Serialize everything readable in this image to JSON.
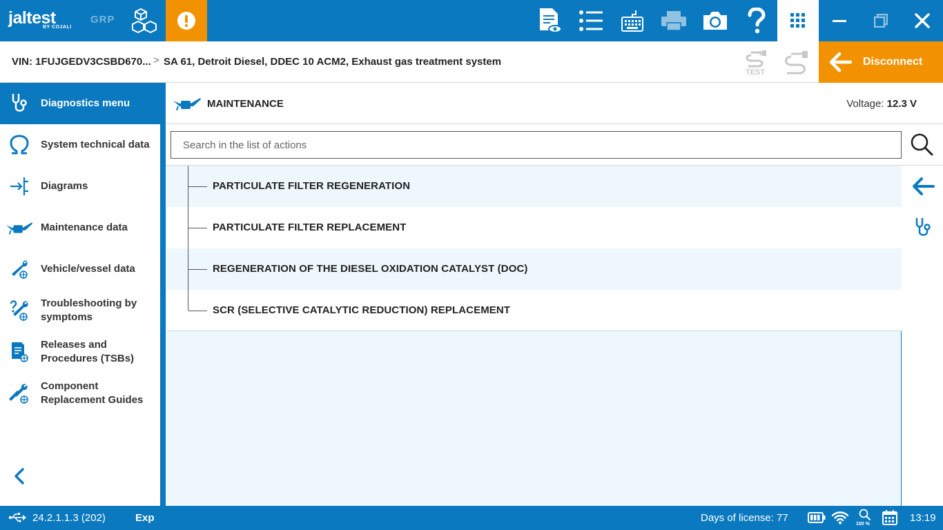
{
  "brand": {
    "logo_main": "jaltest",
    "logo_sub": "BY COJALI",
    "grp": "GRP"
  },
  "colors": {
    "primary": "#0b79bf",
    "accent": "#f39200",
    "row_tint": "#eef7fc"
  },
  "toolbar": {
    "icons": [
      "alert-icon",
      "report-view-icon",
      "list-icon",
      "keyboard-icon",
      "printer-icon",
      "camera-icon",
      "help-icon",
      "apps-grid-icon",
      "minimize-icon",
      "restore-icon",
      "close-icon"
    ]
  },
  "breadcrumb": {
    "vin": "VIN: 1FUJGEDV3CSBD670...",
    "separator": ">",
    "path": "SA 61, Detroit Diesel, DDEC 10 ACM2, Exhaust gas treatment system"
  },
  "connection": {
    "test_label": "TEST",
    "disconnect_label": "Disconnect"
  },
  "sidebar": {
    "items": [
      {
        "label": "Diagnostics menu",
        "icon": "stethoscope-icon"
      },
      {
        "label": "System technical data",
        "icon": "omega-icon"
      },
      {
        "label": "Diagrams",
        "icon": "diagram-icon"
      },
      {
        "label": "Maintenance data",
        "icon": "oil-can-icon"
      },
      {
        "label": "Vehicle/vessel data",
        "icon": "wrench-globe-icon"
      },
      {
        "label": "Troubleshooting by symptoms",
        "icon": "troubleshoot-icon"
      },
      {
        "label": "Releases and Procedures (TSBs)",
        "icon": "tsb-document-icon"
      },
      {
        "label": "Component Replacement Guides",
        "icon": "tools-globe-icon"
      }
    ]
  },
  "main": {
    "section_title": "MAINTENANCE",
    "voltage_label": "Voltage:",
    "voltage_value": "12.3 V",
    "search_placeholder": "Search in the list of actions",
    "search_value": "",
    "actions": [
      "PARTICULATE FILTER REGENERATION",
      "PARTICULATE FILTER REPLACEMENT",
      "REGENERATION OF THE DIESEL OXIDATION CATALYST (DOC)",
      "SCR (SELECTIVE CATALYTIC REDUCTION) REPLACEMENT"
    ]
  },
  "status": {
    "version": "24.2.1.1.3 (202)",
    "mode": "Exp",
    "license": "Days of license: 77",
    "zoom": "100 %",
    "time": "13:19"
  }
}
